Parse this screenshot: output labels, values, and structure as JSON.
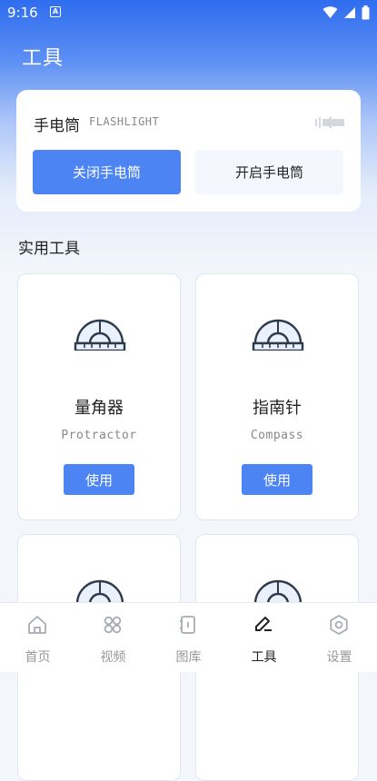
{
  "status_bar": {
    "time": "9:16"
  },
  "page": {
    "title": "工具"
  },
  "flashlight": {
    "title": "手电筒",
    "subtitle": "FLASHLIGHT",
    "off_label": "关闭手电筒",
    "on_label": "开启手电筒"
  },
  "tools_section": {
    "title": "实用工具",
    "items": [
      {
        "name": "量角器",
        "en": "Protractor",
        "button": "使用"
      },
      {
        "name": "指南针",
        "en": "Compass",
        "button": "使用"
      }
    ]
  },
  "bottom_nav": {
    "items": [
      {
        "label": "首页",
        "icon": "home-icon"
      },
      {
        "label": "视频",
        "icon": "video-icon"
      },
      {
        "label": "图库",
        "icon": "gallery-icon"
      },
      {
        "label": "工具",
        "icon": "tools-icon",
        "active": true
      },
      {
        "label": "设置",
        "icon": "settings-icon"
      }
    ]
  },
  "colors": {
    "accent": "#4c85f3",
    "header": "#2f6df0"
  }
}
